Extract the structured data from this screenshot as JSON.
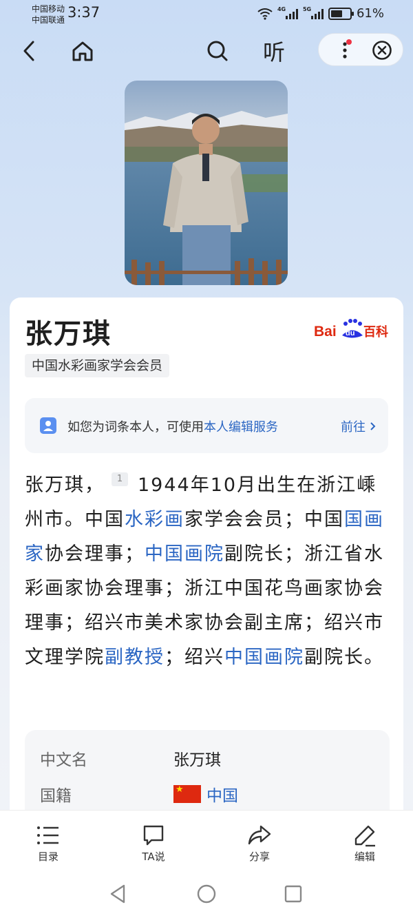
{
  "status_bar": {
    "carrier_1": "中国移动",
    "carrier_2": "中国联通",
    "time": "3:37",
    "net_1": "4G",
    "net_2": "5G",
    "battery": "61%",
    "battery_level": 0.61
  },
  "nav": {
    "back_icon": "chevron-left-icon",
    "home_icon": "home-icon",
    "search_icon": "search-icon",
    "listen_label": "听",
    "more_icon": "more-vertical-icon",
    "close_icon": "close-circle-icon"
  },
  "entry": {
    "title": "张万琪",
    "brand": "Bai du 百科",
    "brand_parts": {
      "bai": "Bai",
      "du": "du",
      "baike": "百科"
    },
    "tag": "中国水彩画家学会会员",
    "notice_text": "如您为词条本人，可使用",
    "notice_link": "本人编辑服务",
    "notice_go": "前往",
    "summary": {
      "p1": "张万琪，",
      "ref": "1",
      "p2": "1944年10月出生在浙江嵊州市。中国",
      "l1": "水彩画",
      "p3": "家学会会员；中国",
      "l2": "国画家",
      "p4": "协会理事；",
      "l3": "中国画院",
      "p5": "副院长；浙江省水彩画家协会理事；浙江中国花鸟画家协会理事；绍兴市美术家协会副主席；绍兴市文理学院",
      "l4": "副教授",
      "p6": "；绍兴",
      "l5": "中国画院",
      "p7": "副院长。"
    },
    "infobox": [
      {
        "key": "中文名",
        "value": "张万琪"
      },
      {
        "key": "国籍",
        "value": "中国"
      }
    ]
  },
  "toolbar": [
    {
      "icon": "list-icon",
      "label": "目录"
    },
    {
      "icon": "chat-bubble-icon",
      "label": "TA说"
    },
    {
      "icon": "share-icon",
      "label": "分享"
    },
    {
      "icon": "edit-pen-icon",
      "label": "编辑"
    }
  ],
  "colors": {
    "link": "#2b66c3",
    "brand_red": "#de2910",
    "brand_blue": "#2932e1"
  }
}
